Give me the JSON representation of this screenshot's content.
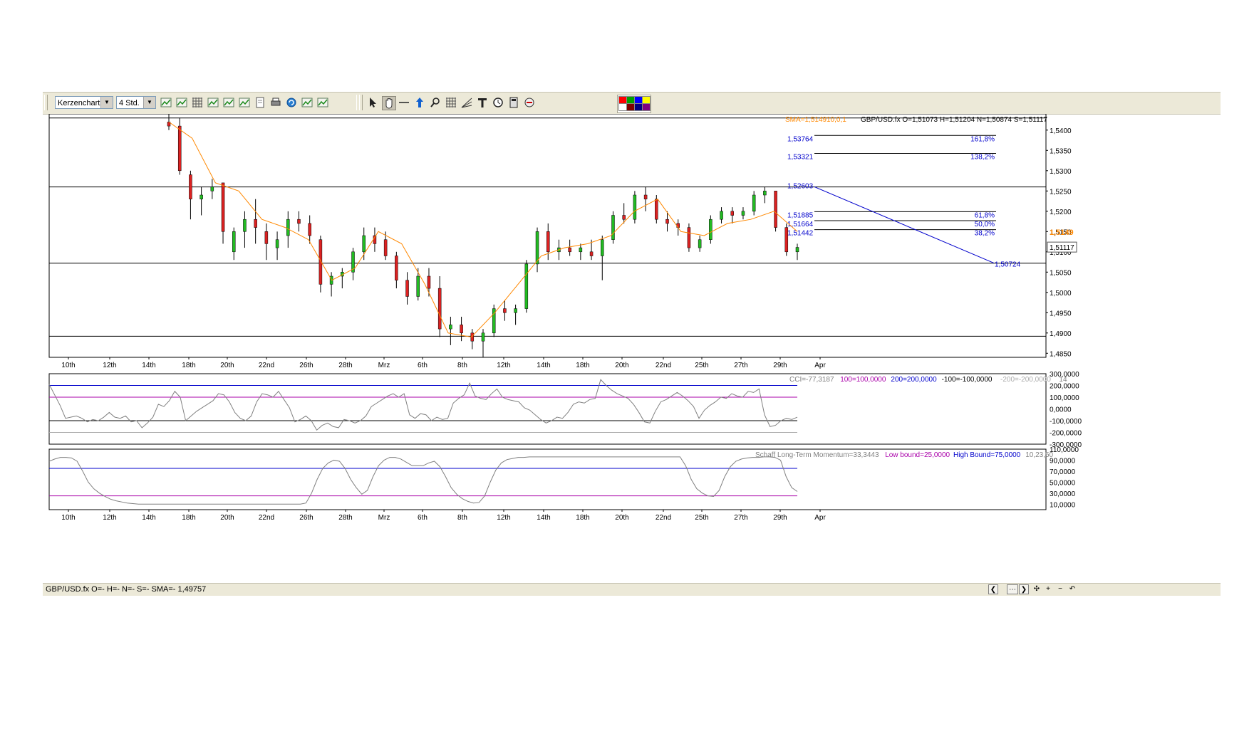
{
  "toolbar": {
    "chart_type": "Kerzenchart",
    "timeframe": "4 Std.",
    "icons_left": [
      "indicator-icon",
      "settings-gear-icon",
      "grid-icon",
      "add-indicator-icon",
      "trend-up-icon",
      "chart-template-icon",
      "document-icon",
      "print-icon",
      "refresh-icon",
      "zoom-chart-icon",
      "export-icon"
    ],
    "icons_right": [
      "pointer-icon",
      "hand-pan-icon",
      "horizontal-line-icon",
      "arrow-up-icon",
      "zoom-icon",
      "grid-lines-icon",
      "fibonacci-fan-icon",
      "text-tool-icon",
      "clock-icon",
      "calculator-icon",
      "eraser-icon"
    ],
    "swatch_colors": [
      "#ff0000",
      "#00a000",
      "#0000ff",
      "#ffff00",
      "#ffffff",
      "#800000",
      "#000080",
      "#800080"
    ]
  },
  "main_chart": {
    "sma_label": "SMA=1,5149",
    "sma_params": "10,0,1",
    "ohlc_label": "GBP/USD.fx O=1,51073 H=1,51204 N=1,50874 S=1,51117",
    "current_price": "1,51117",
    "sma_price": "1,5149",
    "fib_labels": [
      {
        "price": "1,53764",
        "pct": "161,8%"
      },
      {
        "price": "1,53321",
        "pct": "138,2%"
      },
      {
        "price": "1,52603",
        "pct": ""
      },
      {
        "price": "1,51885",
        "pct": "61,8%"
      },
      {
        "price": "1,51664",
        "pct": "50,0%"
      },
      {
        "price": "1,51442",
        "pct": "38,2%"
      },
      {
        "price": "1,50724",
        "pct": ""
      }
    ],
    "y_ticks": [
      "1,5400",
      "1,5350",
      "1,5300",
      "1,5250",
      "1,5200",
      "1,5150",
      "1,5100",
      "1,5050",
      "1,5000",
      "1,4950",
      "1,4900",
      "1,4850"
    ]
  },
  "x_ticks": [
    "10th",
    "12th",
    "14th",
    "18th",
    "20th",
    "22nd",
    "26th",
    "28th",
    "Mrz",
    "6th",
    "8th",
    "12th",
    "14th",
    "18th",
    "20th",
    "22nd",
    "25th",
    "27th",
    "29th",
    "Apr"
  ],
  "cci": {
    "label_main": "CCI=-77,3187",
    "label_100": "100=100,0000",
    "label_200": "200=200,0000",
    "label_m100": "-100=-100,0000",
    "label_m200": "-200=-200,0000",
    "period": "14",
    "y_ticks": [
      "300,0000",
      "200,0000",
      "100,0000",
      "0,0000",
      "-100,0000",
      "-200,0000",
      "-300,0000"
    ]
  },
  "schaff": {
    "label_main": "Schaff Long-Term Momentum=33,3443",
    "label_low": "Low bound=25,0000",
    "label_high": "High Bound=75,0000",
    "params": "10,23,50",
    "y_ticks": [
      "110,0000",
      "90,0000",
      "70,0000",
      "50,0000",
      "30,0000",
      "10,0000"
    ]
  },
  "status": {
    "text": "GBP/USD.fx O=- H=- N=- S=-  SMA=-   1,49757"
  },
  "colors": {
    "bull": "#22bb22",
    "bear": "#dd2222",
    "sma": "#ff8800",
    "fib": "#0000cc",
    "cci_line": "#808080",
    "band_blue": "#0000cc",
    "band_purple": "#aa00aa"
  },
  "chart_data": {
    "type": "candlestick",
    "series": [
      {
        "name": "SMA",
        "values": [
          1.542,
          1.538,
          1.527,
          1.525,
          1.518,
          1.516,
          1.513,
          1.503,
          1.506,
          1.515,
          1.512,
          1.502,
          1.49,
          1.489,
          1.495,
          1.502,
          1.509,
          1.511,
          1.512,
          1.514,
          1.52,
          1.523,
          1.515,
          1.514,
          1.517,
          1.518,
          1.52,
          1.515
        ]
      }
    ],
    "candles": [
      [
        1.542,
        1.544,
        1.54,
        1.541
      ],
      [
        1.541,
        1.543,
        1.529,
        1.53
      ],
      [
        1.529,
        1.53,
        1.518,
        1.523
      ],
      [
        1.523,
        1.526,
        1.519,
        1.524
      ],
      [
        1.525,
        1.528,
        1.523,
        1.526
      ],
      [
        1.527,
        1.527,
        1.512,
        1.515
      ],
      [
        1.51,
        1.516,
        1.508,
        1.515
      ],
      [
        1.515,
        1.52,
        1.511,
        1.518
      ],
      [
        1.518,
        1.523,
        1.512,
        1.516
      ],
      [
        1.515,
        1.517,
        1.508,
        1.512
      ],
      [
        1.511,
        1.515,
        1.508,
        1.513
      ],
      [
        1.514,
        1.52,
        1.511,
        1.518
      ],
      [
        1.518,
        1.52,
        1.515,
        1.517
      ],
      [
        1.517,
        1.519,
        1.512,
        1.514
      ],
      [
        1.513,
        1.514,
        1.5,
        1.502
      ],
      [
        1.502,
        1.505,
        1.499,
        1.504
      ],
      [
        1.504,
        1.506,
        1.501,
        1.505
      ],
      [
        1.505,
        1.511,
        1.503,
        1.51
      ],
      [
        1.51,
        1.516,
        1.508,
        1.514
      ],
      [
        1.514,
        1.516,
        1.51,
        1.512
      ],
      [
        1.513,
        1.515,
        1.508,
        1.509
      ],
      [
        1.509,
        1.51,
        1.501,
        1.503
      ],
      [
        1.503,
        1.505,
        1.497,
        1.499
      ],
      [
        1.499,
        1.506,
        1.498,
        1.504
      ],
      [
        1.504,
        1.506,
        1.499,
        1.501
      ],
      [
        1.501,
        1.504,
        1.489,
        1.491
      ],
      [
        1.491,
        1.494,
        1.487,
        1.492
      ],
      [
        1.492,
        1.494,
        1.488,
        1.49
      ],
      [
        1.49,
        1.491,
        1.486,
        1.488
      ],
      [
        1.488,
        1.491,
        1.484,
        1.49
      ],
      [
        1.49,
        1.497,
        1.489,
        1.496
      ],
      [
        1.496,
        1.498,
        1.493,
        1.495
      ],
      [
        1.495,
        1.497,
        1.492,
        1.496
      ],
      [
        1.496,
        1.508,
        1.495,
        1.507
      ],
      [
        1.507,
        1.516,
        1.505,
        1.515
      ],
      [
        1.515,
        1.517,
        1.508,
        1.51
      ],
      [
        1.51,
        1.513,
        1.508,
        1.511
      ],
      [
        1.511,
        1.513,
        1.509,
        1.51
      ],
      [
        1.51,
        1.512,
        1.508,
        1.511
      ],
      [
        1.51,
        1.513,
        1.508,
        1.509
      ],
      [
        1.509,
        1.514,
        1.503,
        1.513
      ],
      [
        1.513,
        1.52,
        1.512,
        1.519
      ],
      [
        1.519,
        1.522,
        1.517,
        1.518
      ],
      [
        1.518,
        1.525,
        1.517,
        1.524
      ],
      [
        1.524,
        1.526,
        1.52,
        1.523
      ],
      [
        1.523,
        1.524,
        1.517,
        1.518
      ],
      [
        1.518,
        1.52,
        1.515,
        1.517
      ],
      [
        1.517,
        1.518,
        1.514,
        1.516
      ],
      [
        1.516,
        1.517,
        1.51,
        1.511
      ],
      [
        1.511,
        1.514,
        1.51,
        1.513
      ],
      [
        1.513,
        1.519,
        1.512,
        1.518
      ],
      [
        1.518,
        1.521,
        1.517,
        1.52
      ],
      [
        1.52,
        1.521,
        1.517,
        1.519
      ],
      [
        1.519,
        1.521,
        1.518,
        1.52
      ],
      [
        1.52,
        1.525,
        1.519,
        1.524
      ],
      [
        1.524,
        1.526,
        1.522,
        1.525
      ],
      [
        1.525,
        1.525,
        1.515,
        1.516
      ],
      [
        1.516,
        1.517,
        1.509,
        1.51
      ],
      [
        1.51,
        1.512,
        1.508,
        1.5111
      ]
    ],
    "price_range": [
      1.484,
      1.544
    ],
    "fib_levels": [
      {
        "price": 1.53764,
        "pct": "161,8%"
      },
      {
        "price": 1.53321,
        "pct": "138,2%"
      },
      {
        "price": 1.52603,
        "pct": ""
      },
      {
        "price": 1.51885,
        "pct": "61,8%"
      },
      {
        "price": 1.51664,
        "pct": "50,0%"
      },
      {
        "price": 1.51442,
        "pct": "38,2%"
      },
      {
        "price": 1.50724,
        "pct": ""
      }
    ],
    "horizontal_lines": [
      1.543,
      1.526,
      1.5072,
      1.4892
    ],
    "trendline": [
      {
        "i": 38.5,
        "p": 1.526
      },
      {
        "i": 42.5,
        "p": 1.5072
      }
    ],
    "cci": {
      "range": [
        -300,
        300
      ],
      "values": [
        210,
        120,
        30,
        -80,
        -70,
        -60,
        -80,
        -110,
        -90,
        -100,
        -70,
        -30,
        -70,
        -80,
        -60,
        -110,
        -100,
        -160,
        -120,
        -70,
        40,
        20,
        70,
        150,
        100,
        -100,
        -60,
        -20,
        10,
        40,
        70,
        130,
        120,
        60,
        -30,
        -80,
        -100,
        -60,
        60,
        130,
        120,
        100,
        150,
        80,
        10,
        -110,
        -90,
        -60,
        -100,
        -180,
        -140,
        -120,
        -150,
        -160,
        -90,
        -100,
        -120,
        -100,
        -60,
        20,
        50,
        80,
        110,
        130,
        100,
        130,
        -50,
        -80,
        -40,
        -50,
        -100,
        -70,
        -90,
        -80,
        50,
        90,
        120,
        220,
        110,
        90,
        80,
        130,
        170,
        100,
        80,
        70,
        60,
        10,
        -10,
        -50,
        -90,
        -120,
        -100,
        -70,
        -80,
        -30,
        40,
        60,
        50,
        80,
        90,
        250,
        200,
        160,
        130,
        110,
        90,
        40,
        -30,
        -110,
        -120,
        -20,
        60,
        80,
        110,
        140,
        110,
        70,
        20,
        -80,
        -10,
        30,
        60,
        100,
        90,
        130,
        110,
        100,
        150,
        140,
        170,
        -50,
        -150,
        -140,
        -100,
        -80,
        -90,
        -70
      ],
      "bands": [
        200,
        100,
        -100,
        -200
      ]
    },
    "schaff": {
      "range": [
        0,
        110
      ],
      "values": [
        88,
        92,
        95,
        95,
        94,
        88,
        70,
        50,
        38,
        30,
        24,
        19,
        16,
        14,
        12,
        11,
        10,
        10,
        10,
        10,
        10,
        10,
        10,
        10,
        10,
        10,
        10,
        10,
        10,
        10,
        10,
        10,
        10,
        10,
        10,
        10,
        10,
        10,
        10,
        10,
        10,
        10,
        10,
        10,
        10,
        10,
        12,
        30,
        55,
        75,
        85,
        90,
        88,
        75,
        55,
        40,
        28,
        35,
        60,
        80,
        90,
        95,
        95,
        92,
        86,
        80,
        80,
        80,
        85,
        88,
        78,
        60,
        40,
        28,
        20,
        15,
        12,
        13,
        25,
        50,
        72,
        85,
        91,
        93,
        95,
        95,
        96,
        96,
        96,
        96,
        96,
        96,
        96,
        96,
        96,
        96,
        96,
        96,
        96,
        96,
        96,
        96,
        96,
        96,
        96,
        96,
        96,
        96,
        96,
        96,
        96,
        96,
        96,
        96,
        80,
        55,
        38,
        30,
        25,
        24,
        35,
        60,
        78,
        88,
        92,
        94,
        95,
        95,
        96,
        96,
        95,
        90,
        60,
        40,
        33
      ],
      "bands": [
        75,
        25
      ]
    }
  }
}
